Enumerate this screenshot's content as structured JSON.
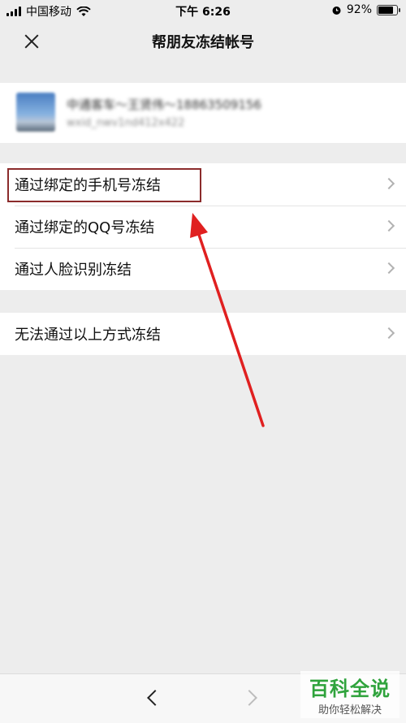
{
  "status_bar": {
    "carrier": "中国移动",
    "time": "下午 6:26",
    "battery": "92%",
    "battery_level": 0.92
  },
  "nav": {
    "title": "帮朋友冻结帐号"
  },
  "account": {
    "name": "中通客车～王贤伟～18863509156",
    "wxid": "wxid_nwv1nd412x422"
  },
  "options_group1": [
    {
      "label": "通过绑定的手机号冻结"
    },
    {
      "label": "通过绑定的QQ号冻结"
    },
    {
      "label": "通过人脸识别冻结"
    }
  ],
  "options_group2": [
    {
      "label": "无法通过以上方式冻结"
    }
  ],
  "watermark": {
    "main": "百科全说",
    "sub": "助你轻松解决"
  },
  "colors": {
    "annotation_red": "#e02020",
    "highlight_border": "#8b2b2b",
    "watermark_green": "#2fa33c"
  }
}
